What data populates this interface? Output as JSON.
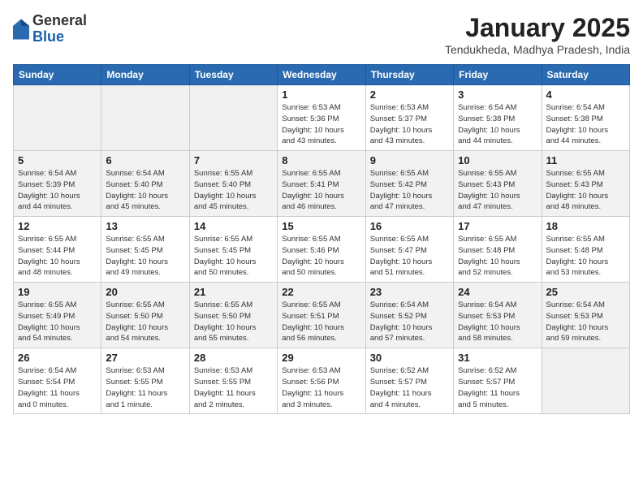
{
  "logo": {
    "general": "General",
    "blue": "Blue"
  },
  "header": {
    "month": "January 2025",
    "location": "Tendukheda, Madhya Pradesh, India"
  },
  "weekdays": [
    "Sunday",
    "Monday",
    "Tuesday",
    "Wednesday",
    "Thursday",
    "Friday",
    "Saturday"
  ],
  "weeks": [
    [
      {
        "day": "",
        "info": ""
      },
      {
        "day": "",
        "info": ""
      },
      {
        "day": "",
        "info": ""
      },
      {
        "day": "1",
        "info": "Sunrise: 6:53 AM\nSunset: 5:36 PM\nDaylight: 10 hours\nand 43 minutes."
      },
      {
        "day": "2",
        "info": "Sunrise: 6:53 AM\nSunset: 5:37 PM\nDaylight: 10 hours\nand 43 minutes."
      },
      {
        "day": "3",
        "info": "Sunrise: 6:54 AM\nSunset: 5:38 PM\nDaylight: 10 hours\nand 44 minutes."
      },
      {
        "day": "4",
        "info": "Sunrise: 6:54 AM\nSunset: 5:38 PM\nDaylight: 10 hours\nand 44 minutes."
      }
    ],
    [
      {
        "day": "5",
        "info": "Sunrise: 6:54 AM\nSunset: 5:39 PM\nDaylight: 10 hours\nand 44 minutes."
      },
      {
        "day": "6",
        "info": "Sunrise: 6:54 AM\nSunset: 5:40 PM\nDaylight: 10 hours\nand 45 minutes."
      },
      {
        "day": "7",
        "info": "Sunrise: 6:55 AM\nSunset: 5:40 PM\nDaylight: 10 hours\nand 45 minutes."
      },
      {
        "day": "8",
        "info": "Sunrise: 6:55 AM\nSunset: 5:41 PM\nDaylight: 10 hours\nand 46 minutes."
      },
      {
        "day": "9",
        "info": "Sunrise: 6:55 AM\nSunset: 5:42 PM\nDaylight: 10 hours\nand 47 minutes."
      },
      {
        "day": "10",
        "info": "Sunrise: 6:55 AM\nSunset: 5:43 PM\nDaylight: 10 hours\nand 47 minutes."
      },
      {
        "day": "11",
        "info": "Sunrise: 6:55 AM\nSunset: 5:43 PM\nDaylight: 10 hours\nand 48 minutes."
      }
    ],
    [
      {
        "day": "12",
        "info": "Sunrise: 6:55 AM\nSunset: 5:44 PM\nDaylight: 10 hours\nand 48 minutes."
      },
      {
        "day": "13",
        "info": "Sunrise: 6:55 AM\nSunset: 5:45 PM\nDaylight: 10 hours\nand 49 minutes."
      },
      {
        "day": "14",
        "info": "Sunrise: 6:55 AM\nSunset: 5:45 PM\nDaylight: 10 hours\nand 50 minutes."
      },
      {
        "day": "15",
        "info": "Sunrise: 6:55 AM\nSunset: 5:46 PM\nDaylight: 10 hours\nand 50 minutes."
      },
      {
        "day": "16",
        "info": "Sunrise: 6:55 AM\nSunset: 5:47 PM\nDaylight: 10 hours\nand 51 minutes."
      },
      {
        "day": "17",
        "info": "Sunrise: 6:55 AM\nSunset: 5:48 PM\nDaylight: 10 hours\nand 52 minutes."
      },
      {
        "day": "18",
        "info": "Sunrise: 6:55 AM\nSunset: 5:48 PM\nDaylight: 10 hours\nand 53 minutes."
      }
    ],
    [
      {
        "day": "19",
        "info": "Sunrise: 6:55 AM\nSunset: 5:49 PM\nDaylight: 10 hours\nand 54 minutes."
      },
      {
        "day": "20",
        "info": "Sunrise: 6:55 AM\nSunset: 5:50 PM\nDaylight: 10 hours\nand 54 minutes."
      },
      {
        "day": "21",
        "info": "Sunrise: 6:55 AM\nSunset: 5:50 PM\nDaylight: 10 hours\nand 55 minutes."
      },
      {
        "day": "22",
        "info": "Sunrise: 6:55 AM\nSunset: 5:51 PM\nDaylight: 10 hours\nand 56 minutes."
      },
      {
        "day": "23",
        "info": "Sunrise: 6:54 AM\nSunset: 5:52 PM\nDaylight: 10 hours\nand 57 minutes."
      },
      {
        "day": "24",
        "info": "Sunrise: 6:54 AM\nSunset: 5:53 PM\nDaylight: 10 hours\nand 58 minutes."
      },
      {
        "day": "25",
        "info": "Sunrise: 6:54 AM\nSunset: 5:53 PM\nDaylight: 10 hours\nand 59 minutes."
      }
    ],
    [
      {
        "day": "26",
        "info": "Sunrise: 6:54 AM\nSunset: 5:54 PM\nDaylight: 11 hours\nand 0 minutes."
      },
      {
        "day": "27",
        "info": "Sunrise: 6:53 AM\nSunset: 5:55 PM\nDaylight: 11 hours\nand 1 minute."
      },
      {
        "day": "28",
        "info": "Sunrise: 6:53 AM\nSunset: 5:55 PM\nDaylight: 11 hours\nand 2 minutes."
      },
      {
        "day": "29",
        "info": "Sunrise: 6:53 AM\nSunset: 5:56 PM\nDaylight: 11 hours\nand 3 minutes."
      },
      {
        "day": "30",
        "info": "Sunrise: 6:52 AM\nSunset: 5:57 PM\nDaylight: 11 hours\nand 4 minutes."
      },
      {
        "day": "31",
        "info": "Sunrise: 6:52 AM\nSunset: 5:57 PM\nDaylight: 11 hours\nand 5 minutes."
      },
      {
        "day": "",
        "info": ""
      }
    ]
  ]
}
